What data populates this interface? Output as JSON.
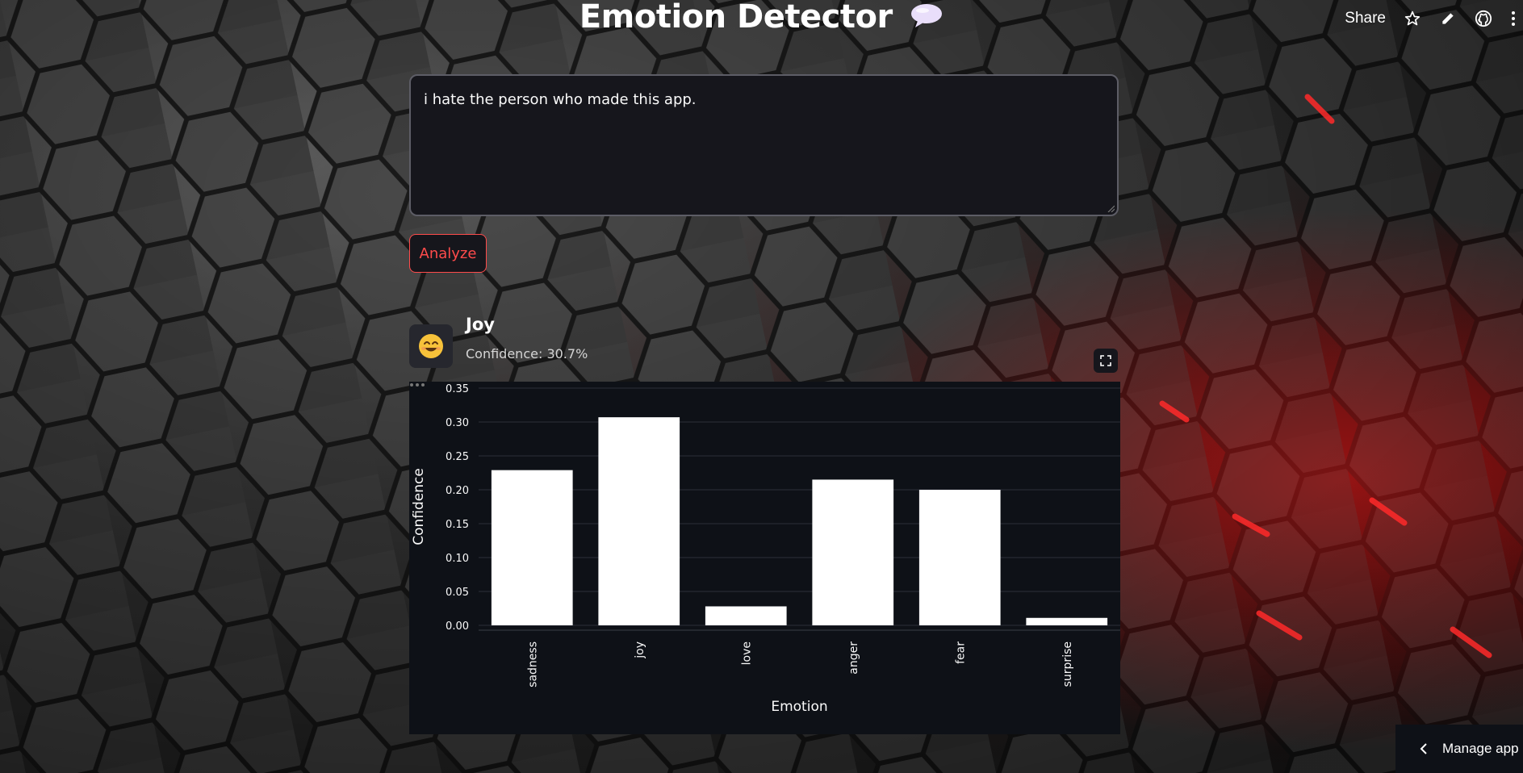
{
  "header": {
    "title": "Emotion Detector",
    "share_label": "Share",
    "icons": [
      "star-icon",
      "pencil-icon",
      "github-icon",
      "more-vertical-icon"
    ]
  },
  "input": {
    "value": "i hate the person who made this app."
  },
  "analyze_button": {
    "label": "Analyze"
  },
  "result": {
    "emoji": "😊",
    "label": "Joy",
    "confidence_text": "Confidence: 30.7%"
  },
  "chart_data": {
    "type": "bar",
    "categories": [
      "sadness",
      "joy",
      "love",
      "anger",
      "fear",
      "surprise"
    ],
    "values": [
      0.229,
      0.307,
      0.028,
      0.215,
      0.2,
      0.011
    ],
    "xlabel": "Emotion",
    "ylabel": "Confidence",
    "ylim": [
      0,
      0.35
    ],
    "yticks": [
      "0.00",
      "0.05",
      "0.10",
      "0.15",
      "0.20",
      "0.25",
      "0.30",
      "0.35"
    ],
    "grid": true,
    "bar_color": "#ffffff"
  },
  "footer": {
    "manage_label": "Manage app"
  },
  "colors": {
    "accent": "#ff4b4b",
    "panel_bg": "#0e1117",
    "input_bg": "#16161c"
  }
}
